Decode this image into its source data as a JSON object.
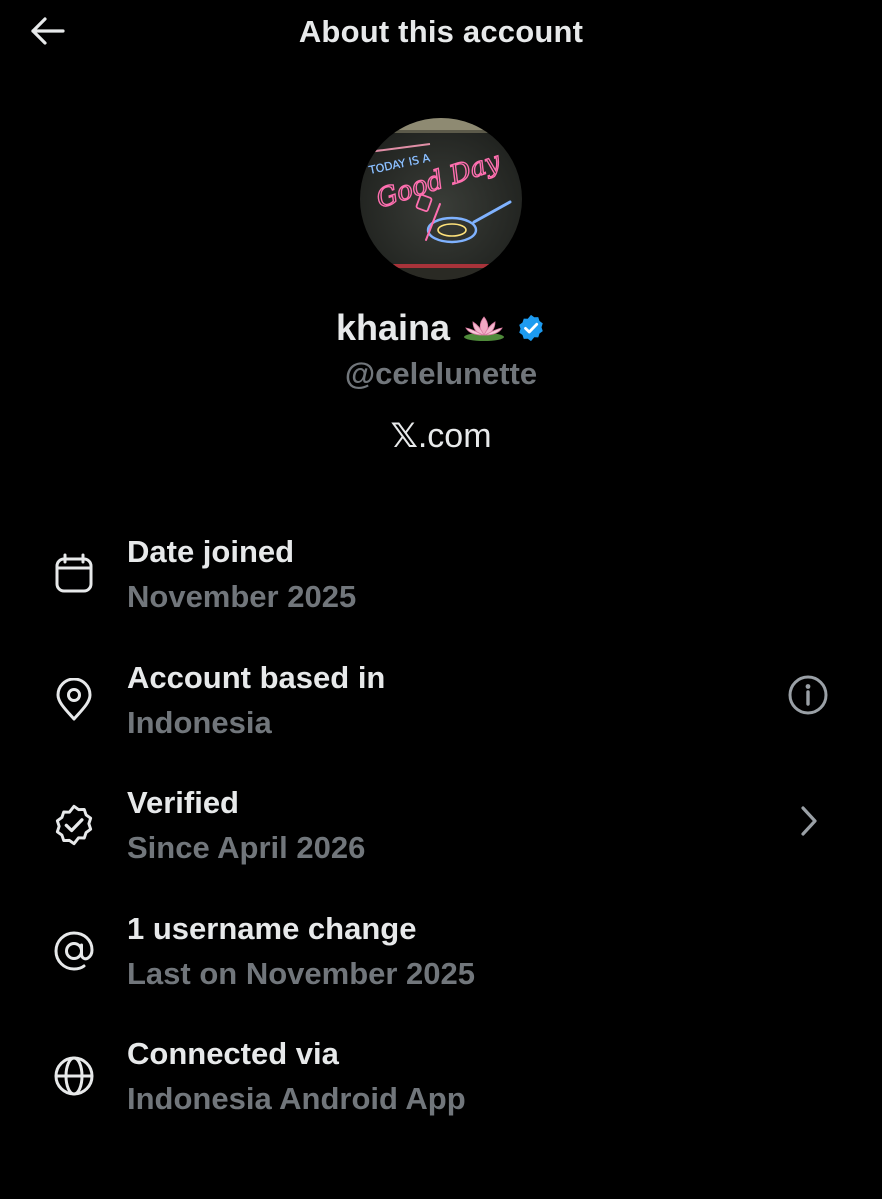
{
  "header": {
    "title": "About this account",
    "back_icon": "arrow-left-icon"
  },
  "profile": {
    "display_name": "khaina",
    "emoji": "🪷",
    "emoji_icon": "lotus-icon",
    "verified": true,
    "verified_color": "#1d9bf0",
    "handle": "@celelunette",
    "website_x": "𝕏",
    "website_rest": ".com",
    "avatar": {
      "icon": "neon-sign-avatar",
      "text_top": "TODAY IS A",
      "text_script": "Good Day"
    }
  },
  "rows": [
    {
      "icon": "calendar-icon",
      "title": "Date joined",
      "value": "November 2025",
      "action": null
    },
    {
      "icon": "location-pin-icon",
      "title": "Account based in",
      "value": "Indonesia",
      "action": "info-icon"
    },
    {
      "icon": "verified-check-icon",
      "title": "Verified",
      "value": "Since April 2026",
      "action": "chevron-right-icon"
    },
    {
      "icon": "at-sign-icon",
      "title": "1 username change",
      "value": "Last on November 2025",
      "action": null
    },
    {
      "icon": "globe-icon",
      "title": "Connected via",
      "value": "Indonesia Android App",
      "action": null
    }
  ],
  "colors": {
    "background": "#000000",
    "primary_text": "#e7e9ea",
    "secondary_text": "#71767b",
    "accent": "#1d9bf0"
  }
}
